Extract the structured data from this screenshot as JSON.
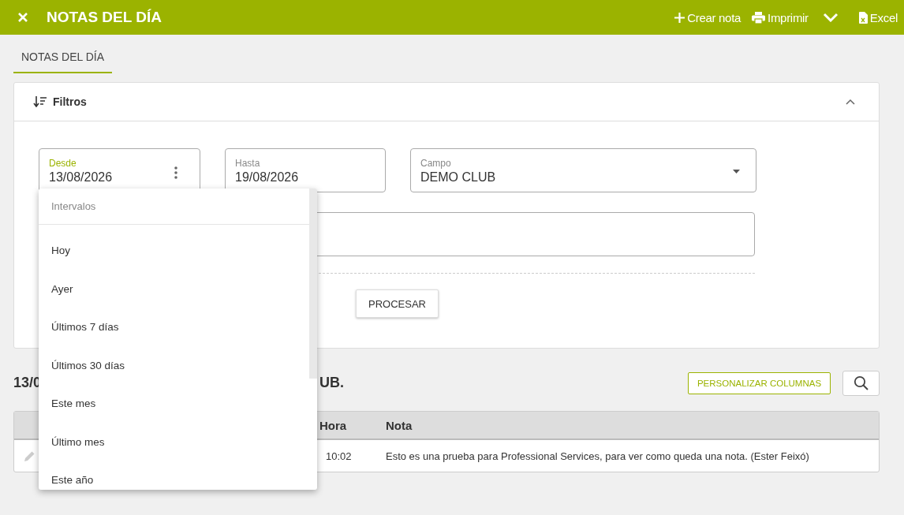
{
  "header": {
    "title": "NOTAS DEL DÍA",
    "actions": [
      {
        "kind": "create",
        "label": "Crear nota"
      },
      {
        "kind": "print",
        "label": "Imprimir"
      },
      {
        "kind": "more"
      },
      {
        "kind": "excel",
        "label": "Excel"
      }
    ]
  },
  "tabs": [
    {
      "label": "NOTAS DEL DÍA",
      "selected": true
    }
  ],
  "filters": {
    "title": "Filtros",
    "expanded": true,
    "fields": [
      {
        "label": "Desde",
        "value": "13/08/2026",
        "focused": true,
        "kind": "menu"
      },
      {
        "label": "Hasta",
        "value": "19/08/2026",
        "focused": false,
        "kind": "plain"
      },
      {
        "label": "Campo",
        "value": "DEMO CLUB",
        "focused": false,
        "kind": "select"
      }
    ],
    "process_button": "PROCESAR"
  },
  "summary": {
    "visible_start": "13/0",
    "visible_end": "UB."
  },
  "customize_button": "PERSONALIZAR COLUMNAS",
  "table": {
    "columns": [
      "Hora",
      "Nota"
    ],
    "rows": [
      {
        "hora": "10:02",
        "nota": "Esto es una prueba para Professional Services, para ver como queda una nota. (Ester Feixó)"
      }
    ]
  },
  "interval_menu": {
    "title": "Intervalos",
    "items": [
      "Hoy",
      "Ayer",
      "Últimos 7 días",
      "Últimos 30 días",
      "Este mes",
      "Último mes",
      "Este año"
    ]
  }
}
